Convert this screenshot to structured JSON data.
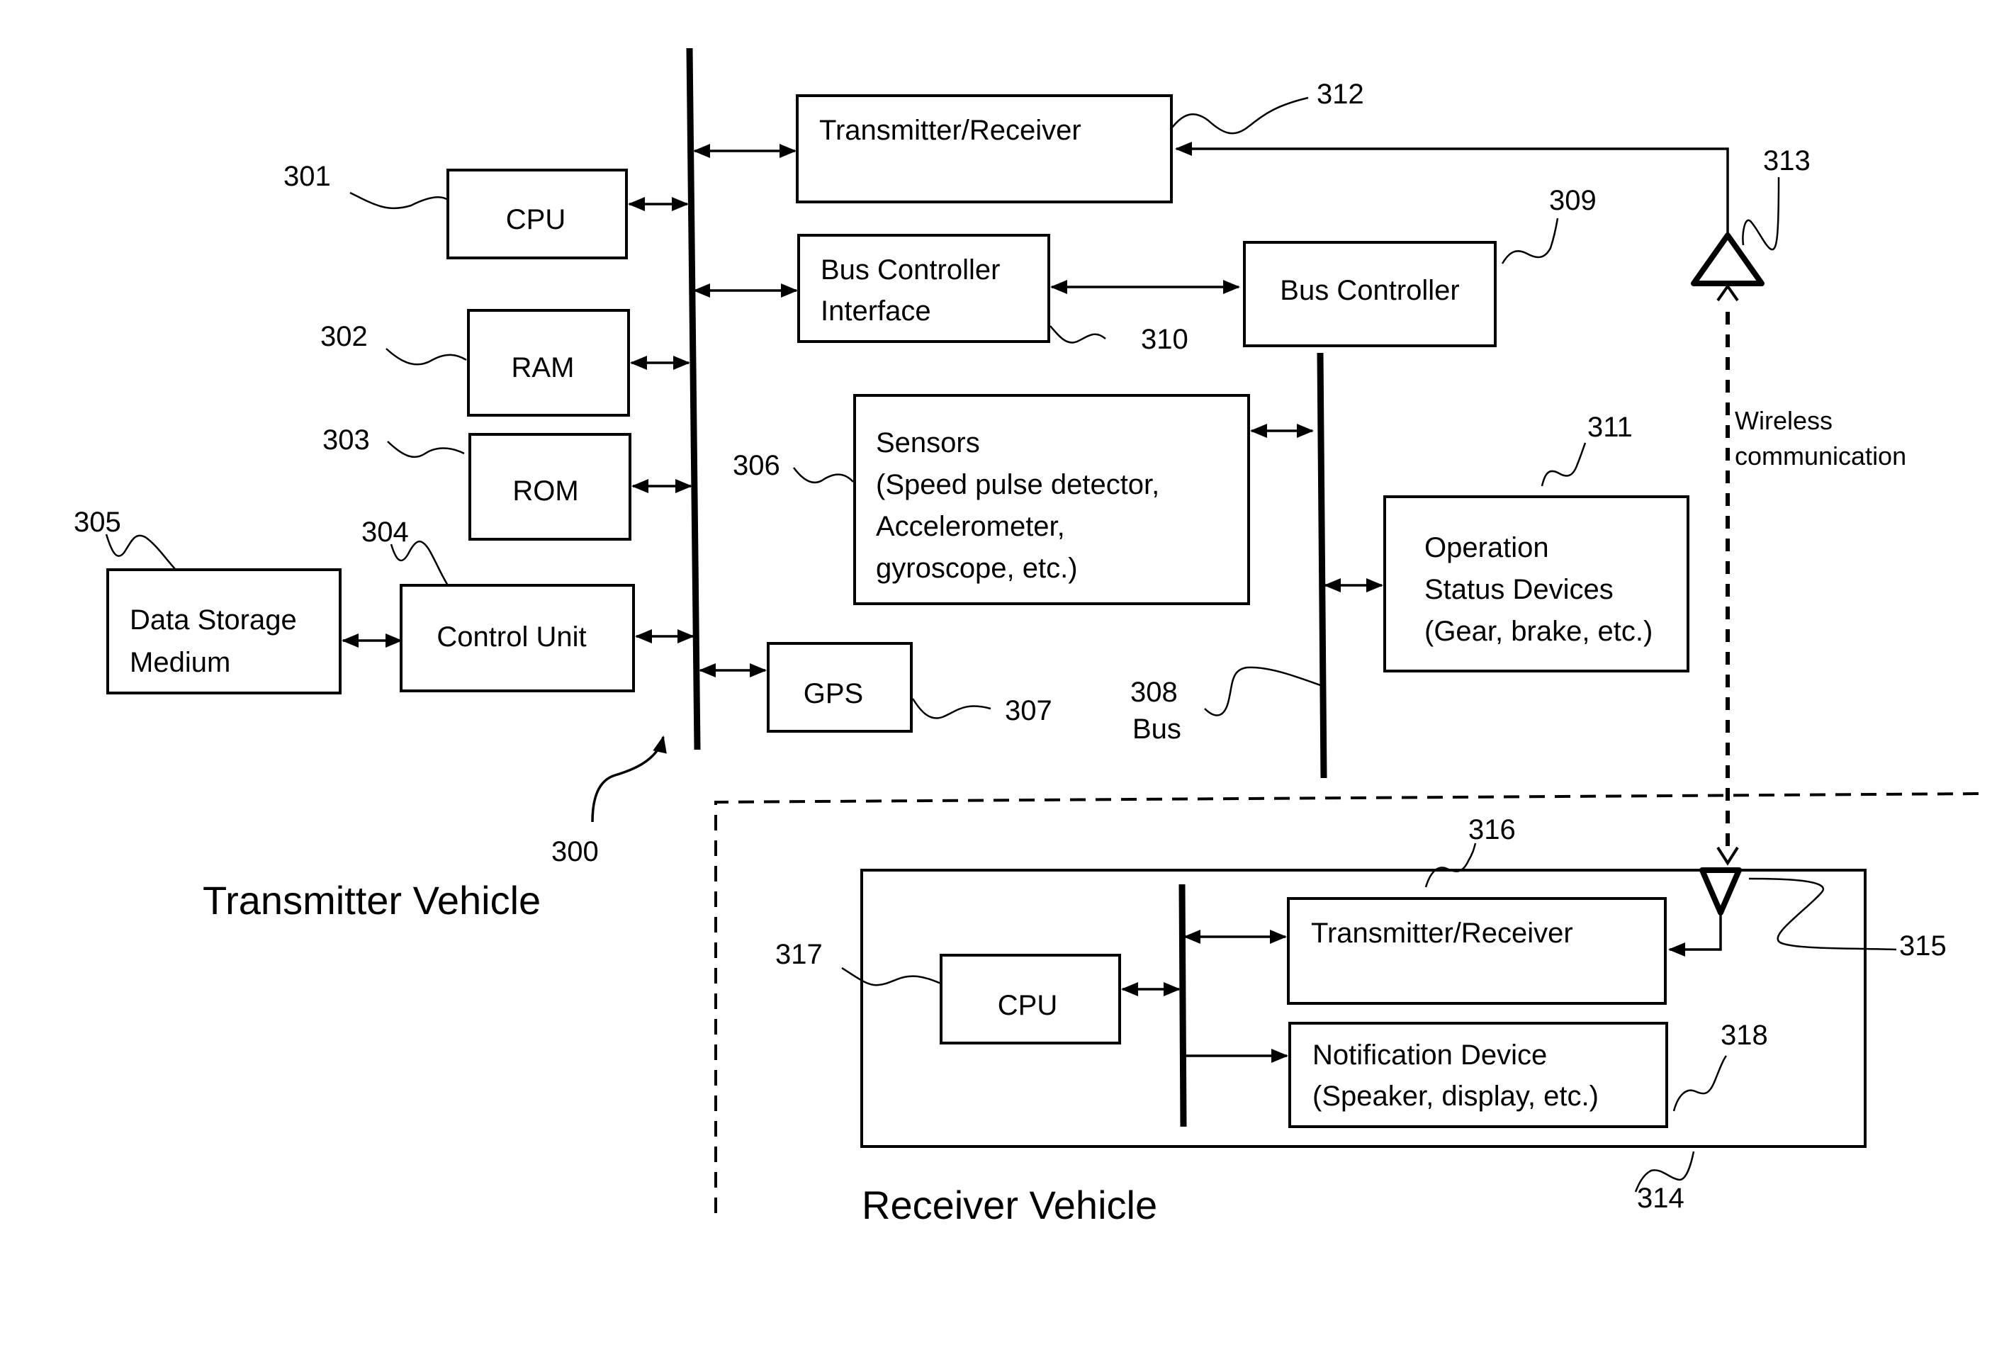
{
  "diagram": {
    "transmitter_vehicle_label": "Transmitter Vehicle",
    "receiver_vehicle_label": "Receiver Vehicle",
    "wireless_label": [
      "Wireless",
      "communication"
    ],
    "blocks": {
      "cpu": {
        "ref": "301",
        "lines": [
          "CPU"
        ]
      },
      "ram": {
        "ref": "302",
        "lines": [
          "RAM"
        ]
      },
      "rom": {
        "ref": "303",
        "lines": [
          "ROM"
        ]
      },
      "control_unit": {
        "ref": "304",
        "lines": [
          "Control Unit"
        ]
      },
      "data_storage": {
        "ref": "305",
        "lines": [
          "Data Storage",
          "Medium"
        ]
      },
      "sensors": {
        "ref": "306",
        "lines": [
          "Sensors",
          "(Speed pulse detector,",
          "Accelerometer,",
          "gyroscope, etc.)"
        ]
      },
      "gps": {
        "ref": "307",
        "lines": [
          "GPS"
        ]
      },
      "bus_308": {
        "ref": "308",
        "label": "Bus"
      },
      "bus_controller": {
        "ref": "309",
        "lines": [
          "Bus Controller"
        ]
      },
      "bus_controller_interface": {
        "ref": "310",
        "lines": [
          "Bus Controller",
          "Interface"
        ]
      },
      "operation_status": {
        "ref": "311",
        "lines": [
          "Operation",
          "Status Devices",
          "(Gear, brake, etc.)"
        ]
      },
      "tx_rx": {
        "ref": "312",
        "lines": [
          "Transmitter/Receiver"
        ]
      },
      "antenna_tx": {
        "ref": "313"
      },
      "receiver_unit": {
        "ref": "314"
      },
      "antenna_rx": {
        "ref": "315"
      },
      "rx_tx_rx": {
        "ref": "316",
        "lines": [
          "Transmitter/Receiver"
        ]
      },
      "rx_cpu": {
        "ref": "317",
        "lines": [
          "CPU"
        ]
      },
      "notification": {
        "ref": "318",
        "lines": [
          "Notification Device",
          "(Speaker, display, etc.)"
        ]
      }
    },
    "system_ref": "300"
  }
}
